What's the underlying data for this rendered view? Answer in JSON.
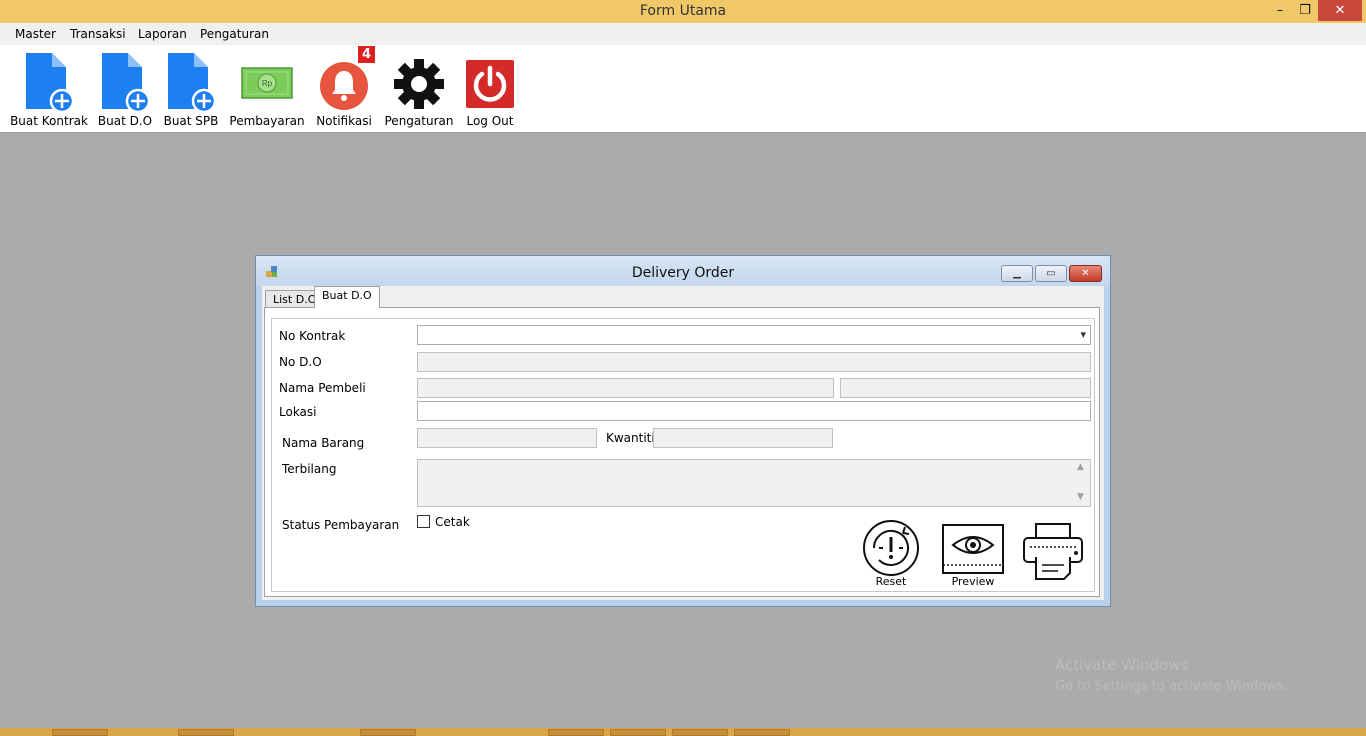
{
  "window": {
    "title": "Form Utama",
    "controls": {
      "minimize": "–",
      "maximize": "❐",
      "close": "✕"
    }
  },
  "menu": [
    "Master",
    "Transaksi",
    "Laporan",
    "Pengaturan"
  ],
  "toolbar": [
    {
      "label": "Buat Kontrak",
      "icon": "file-add-icon"
    },
    {
      "label": "Buat D.O",
      "icon": "file-add-icon"
    },
    {
      "label": "Buat SPB",
      "icon": "file-add-icon"
    },
    {
      "label": "Pembayaran",
      "icon": "money-icon"
    },
    {
      "label": "Notifikasi",
      "icon": "bell-icon",
      "badge": "4"
    },
    {
      "label": "Pengaturan",
      "icon": "gear-icon"
    },
    {
      "label": "Log Out",
      "icon": "power-icon"
    }
  ],
  "child": {
    "title": "Delivery Order",
    "tabs": [
      "List D.O",
      "Buat D.O"
    ],
    "active_tab": "Buat D.O",
    "form": {
      "no_kontrak_label": "No Kontrak",
      "no_do_label": "No D.O",
      "nama_pembeli_label": "Nama Pembeli",
      "lokasi_label": "Lokasi",
      "nama_barang_label": "Nama Barang",
      "kwantiti_label": "Kwantiti",
      "terbilang_label": "Terbilang",
      "status_pembayaran_label": "Status Pembayaran",
      "cetak_label": "Cetak"
    },
    "actions": [
      {
        "label": "Reset",
        "icon": "reset-icon"
      },
      {
        "label": "Preview",
        "icon": "eye-icon"
      },
      {
        "label": "",
        "icon": "printer-icon"
      }
    ]
  },
  "watermark": [
    "Activate Windows",
    "Go to Settings to activate Windows."
  ],
  "colors": {
    "titlebar": "#f0c868",
    "file_icon": "#1e7ff0",
    "bell": "#e8553f",
    "power": "#d42a2a",
    "badge": "#e02020",
    "money": "#7ccc5a"
  }
}
